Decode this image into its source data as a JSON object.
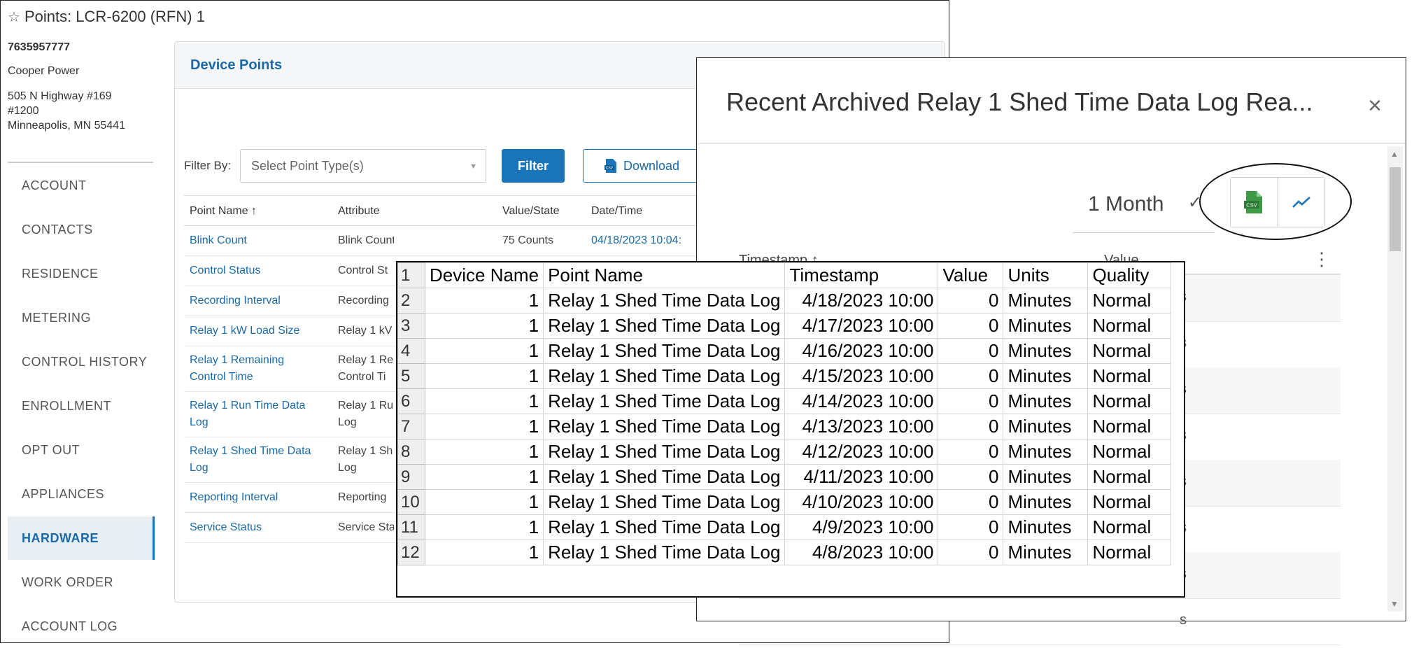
{
  "window": {
    "title": "Points: LCR-6200 (RFN) 1"
  },
  "account": {
    "id": "7635957777",
    "company": "Cooper Power",
    "address_line1": "505 N Highway #169",
    "address_line2": "#1200",
    "address_line3": "Minneapolis, MN 55441"
  },
  "sidebar": {
    "items": [
      {
        "label": "ACCOUNT"
      },
      {
        "label": "CONTACTS"
      },
      {
        "label": "RESIDENCE"
      },
      {
        "label": "METERING"
      },
      {
        "label": "CONTROL HISTORY"
      },
      {
        "label": "ENROLLMENT"
      },
      {
        "label": "OPT OUT"
      },
      {
        "label": "APPLIANCES"
      },
      {
        "label": "HARDWARE"
      },
      {
        "label": "WORK ORDER"
      },
      {
        "label": "ACCOUNT LOG"
      }
    ],
    "active": "HARDWARE"
  },
  "panel": {
    "title": "Device Points",
    "filter_label": "Filter By:",
    "filter_placeholder": "Select Point Type(s)",
    "filter_button": "Filter",
    "download_button": "Download",
    "columns": [
      "Point Name ↑",
      "Attribute",
      "Value/State",
      "Date/Time"
    ],
    "rows": [
      {
        "name": "Blink Count",
        "attribute": "Blink Count",
        "value": "75 Counts",
        "date": "04/18/2023 10:04:"
      },
      {
        "name": "Control Status",
        "attribute": "Control St",
        "value": "",
        "date": ""
      },
      {
        "name": "Recording Interval",
        "attribute": "Recording",
        "value": "",
        "date": ""
      },
      {
        "name": "Relay 1 kW Load Size",
        "attribute": "Relay 1 kV",
        "value": "",
        "date": ""
      },
      {
        "name": "Relay 1 Remaining",
        "name2": "Control Time",
        "attribute": "Relay 1 Re",
        "attribute2": "Control Ti",
        "value": "",
        "date": ""
      },
      {
        "name": "Relay 1 Run Time Data",
        "name2": "Log",
        "attribute": "Relay 1 Ru",
        "attribute2": "Log",
        "value": "",
        "date": ""
      },
      {
        "name": "Relay 1 Shed Time Data",
        "name2": "Log",
        "attribute": "Relay 1 Sh",
        "attribute2": "Log",
        "value": "",
        "date": ""
      },
      {
        "name": "Reporting Interval",
        "attribute": "Reporting",
        "value": "",
        "date": ""
      },
      {
        "name": "Service Status",
        "attribute": "Service Sta",
        "value": "",
        "date": ""
      }
    ]
  },
  "modal": {
    "title": "Recent Archived Relay 1 Shed Time Data Log Rea...",
    "close": "×",
    "period": "1 Month",
    "csv_icon": "csv-file-icon",
    "trend_icon": "trend-chart-icon",
    "columns": [
      "Timestamp ↑",
      "Value"
    ],
    "row_fragments": [
      "s",
      "s",
      "s",
      "s",
      "s",
      "s",
      "s",
      "s"
    ]
  },
  "excel": {
    "row_numbers": [
      "1",
      "2",
      "3",
      "4",
      "5",
      "6",
      "7",
      "8",
      "9",
      "10",
      "11",
      "12"
    ],
    "headers": [
      "Device Name",
      "Point Name",
      "Timestamp",
      "Value",
      "Units",
      "Quality"
    ],
    "rows": [
      [
        "1",
        "Relay 1 Shed Time Data Log",
        "4/18/2023 10:00",
        "0",
        "Minutes",
        "Normal"
      ],
      [
        "1",
        "Relay 1 Shed Time Data Log",
        "4/17/2023 10:00",
        "0",
        "Minutes",
        "Normal"
      ],
      [
        "1",
        "Relay 1 Shed Time Data Log",
        "4/16/2023 10:00",
        "0",
        "Minutes",
        "Normal"
      ],
      [
        "1",
        "Relay 1 Shed Time Data Log",
        "4/15/2023 10:00",
        "0",
        "Minutes",
        "Normal"
      ],
      [
        "1",
        "Relay 1 Shed Time Data Log",
        "4/14/2023 10:00",
        "0",
        "Minutes",
        "Normal"
      ],
      [
        "1",
        "Relay 1 Shed Time Data Log",
        "4/13/2023 10:00",
        "0",
        "Minutes",
        "Normal"
      ],
      [
        "1",
        "Relay 1 Shed Time Data Log",
        "4/12/2023 10:00",
        "0",
        "Minutes",
        "Normal"
      ],
      [
        "1",
        "Relay 1 Shed Time Data Log",
        "4/11/2023 10:00",
        "0",
        "Minutes",
        "Normal"
      ],
      [
        "1",
        "Relay 1 Shed Time Data Log",
        "4/10/2023 10:00",
        "0",
        "Minutes",
        "Normal"
      ],
      [
        "1",
        "Relay 1 Shed Time Data Log",
        "4/9/2023 10:00",
        "0",
        "Minutes",
        "Normal"
      ],
      [
        "1",
        "Relay 1 Shed Time Data Log",
        "4/8/2023 10:00",
        "0",
        "Minutes",
        "Normal"
      ]
    ]
  },
  "colors": {
    "accent": "#1a75bb",
    "link": "#1a6aa8",
    "csv_green": "#3d9b45"
  }
}
